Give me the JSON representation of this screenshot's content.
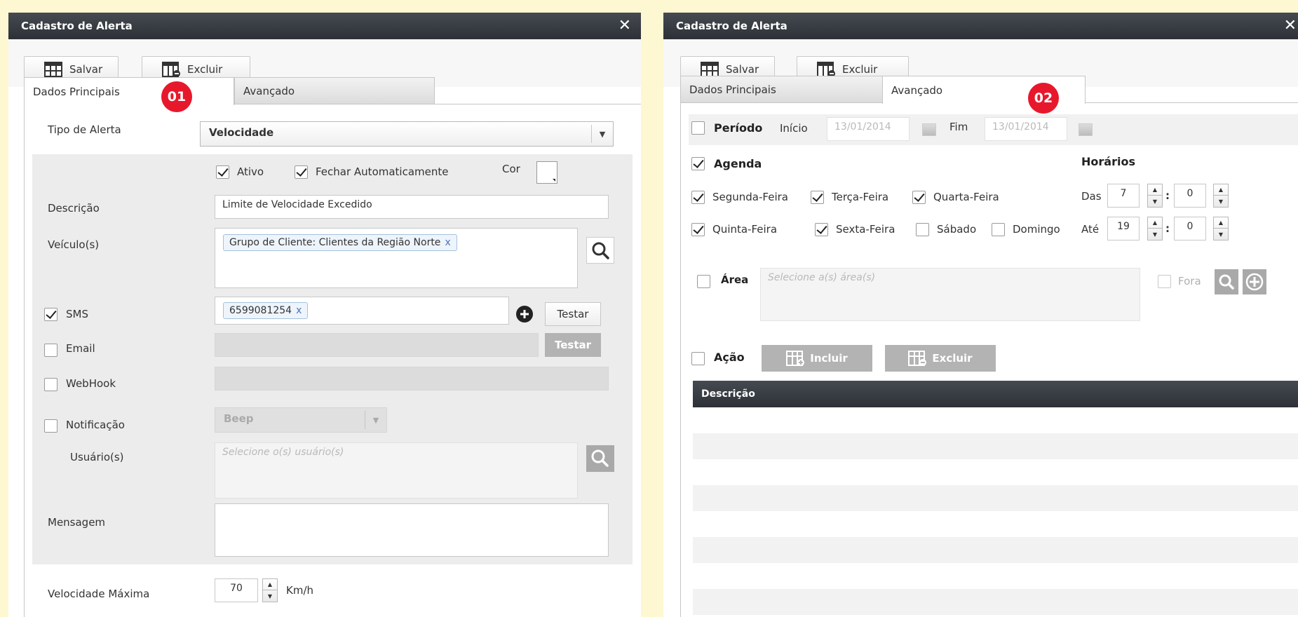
{
  "left": {
    "title": "Cadastro de Alerta",
    "close": "✕",
    "toolbar": {
      "save": "Salvar",
      "delete": "Excluir"
    },
    "tabs": {
      "main": "Dados Principais",
      "advanced": "Avançado"
    },
    "badge": "01",
    "alert_type_label": "Tipo de Alerta",
    "alert_type_value": "Velocidade",
    "active_label": "Ativo",
    "auto_close_label": "Fechar Automaticamente",
    "color_label": "Cor",
    "description_label": "Descrição",
    "description_value": "Limite de Velocidade Excedido",
    "vehicles_label": "Veículo(s)",
    "vehicle_chip": "Grupo de Cliente: Clientes da Região Norte",
    "chip_remove": "x",
    "sms_label": "SMS",
    "sms_chip": "6599081254",
    "test_button": "Testar",
    "email_label": "Email",
    "email_test_button": "Testar",
    "webhook_label": "WebHook",
    "notification_label": "Notificação",
    "notification_value": "Beep",
    "users_label": "Usuário(s)",
    "users_placeholder": "Selecione o(s) usuário(s)",
    "message_label": "Mensagem",
    "max_speed_label": "Velocidade Máxima",
    "max_speed_value": "70",
    "speed_unit": "Km/h"
  },
  "right": {
    "title": "Cadastro de Alerta",
    "close": "✕",
    "toolbar": {
      "save": "Salvar",
      "delete": "Excluir"
    },
    "tabs": {
      "main": "Dados Principais",
      "advanced": "Avançado"
    },
    "badge": "02",
    "period_label": "Período",
    "start_label": "Início",
    "start_value": "13/01/2014",
    "end_label": "Fim",
    "end_value": "13/01/2014",
    "agenda_label": "Agenda",
    "days": [
      "Segunda-Feira",
      "Terça-Feira",
      "Quarta-Feira",
      "Quinta-Feira",
      "Sexta-Feira",
      "Sábado",
      "Domingo"
    ],
    "schedule_title": "Horários",
    "from_label": "Das",
    "from_hour": "7",
    "from_minute": "0",
    "to_label": "Até",
    "to_hour": "19",
    "to_minute": "0",
    "time_sep": ":",
    "area_label": "Área",
    "area_placeholder": "Selecione a(s) área(s)",
    "outside_label": "Fora",
    "action_label": "Ação",
    "include_button": "Incluir",
    "delete_button": "Excluir",
    "table_column": "Descrição"
  }
}
